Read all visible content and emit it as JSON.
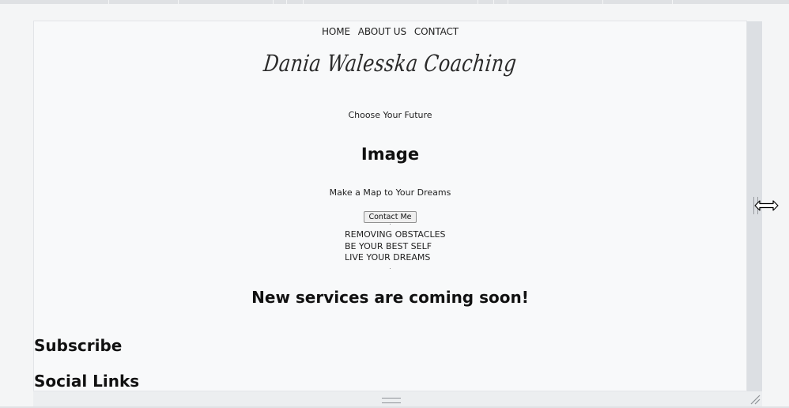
{
  "nav": {
    "items": [
      "HOME",
      "ABOUT US",
      "CONTACT"
    ]
  },
  "logo": {
    "text": "Dania Walesska Coaching"
  },
  "hero": {
    "tagline": "Choose Your Future",
    "image_heading": "Image",
    "subtitle": "Make a Map to Your Dreams",
    "button_label": "Contact Me"
  },
  "services": {
    "items": [
      "REMOVING OBSTACLES",
      "BE YOUR BEST SELF",
      "LIVE YOUR DREAMS"
    ]
  },
  "coming_soon": "New services are coming soon!",
  "subscribe_heading": "Subscribe",
  "social_heading": "Social Links",
  "icons": {
    "cursor": "resize-horizontal-cursor-icon",
    "bottom_grip": "drag-grip-icon",
    "corner_grip": "resize-corner-icon"
  }
}
